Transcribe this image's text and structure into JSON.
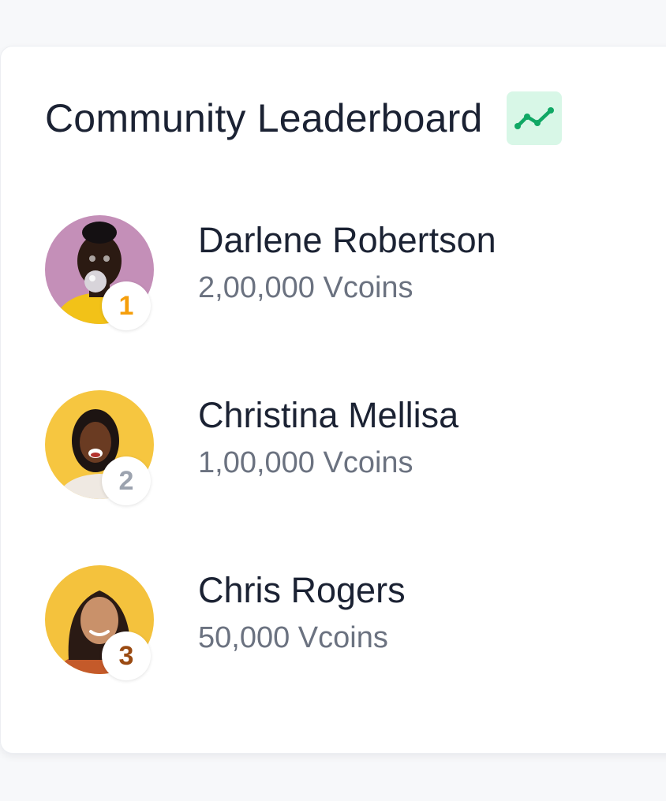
{
  "leaderboard": {
    "title": "Community Leaderboard",
    "trend_icon": "trending-up-icon",
    "trend_colors": {
      "badge_bg": "#d8f7e7",
      "line": "#10a865"
    },
    "entries": [
      {
        "rank": "1",
        "name": "Darlene Robertson",
        "coins": "2,00,000 Vcoins",
        "rank_color": "#f59e0b",
        "avatar_bg": "#c48fb8"
      },
      {
        "rank": "2",
        "name": "Christina Mellisa",
        "coins": "1,00,000 Vcoins",
        "rank_color": "#9ca3af",
        "avatar_bg": "#f6c640"
      },
      {
        "rank": "3",
        "name": "Chris Rogers",
        "coins": "50,000 Vcoins",
        "rank_color": "#9a4a12",
        "avatar_bg": "#f4c23d"
      }
    ]
  }
}
